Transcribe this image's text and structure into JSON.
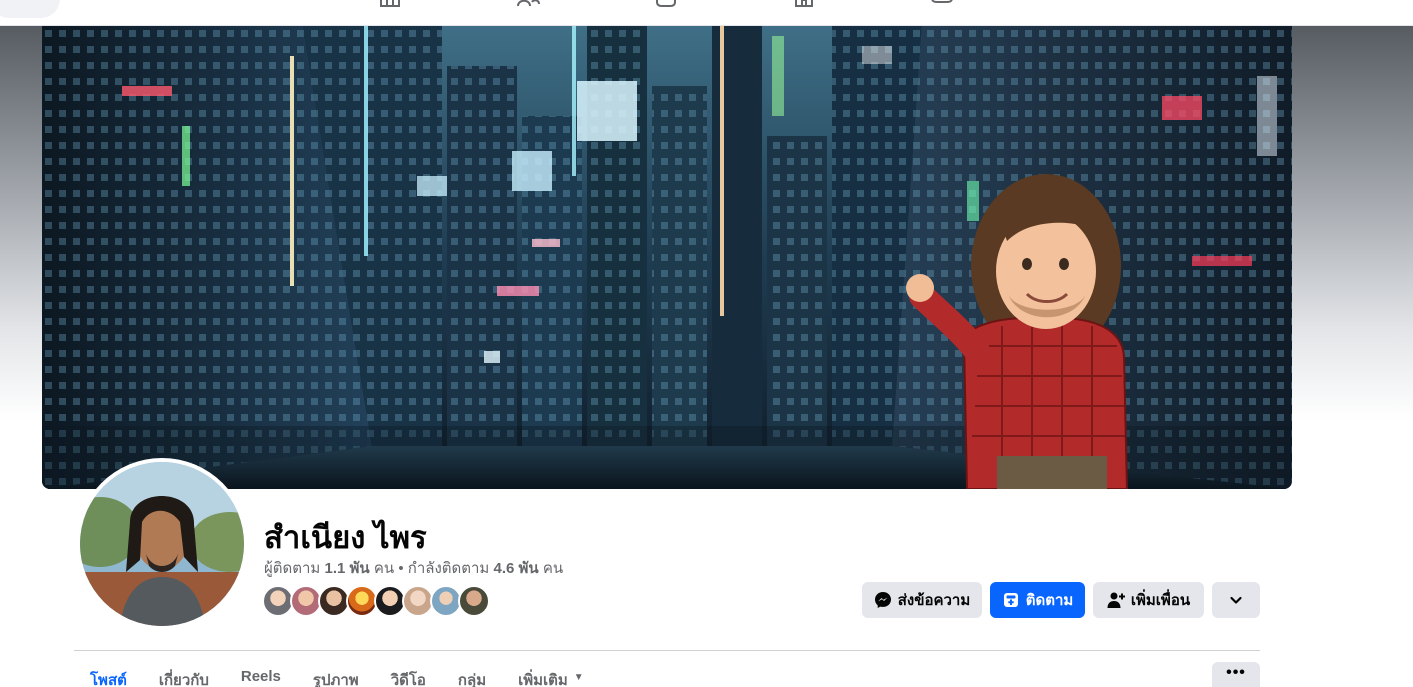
{
  "profile": {
    "name": "สำเนียง ไพร",
    "followers_label": "ผู้ติดตาม",
    "followers_count": "1.1 พัน",
    "followers_unit": "คน",
    "separator": "•",
    "following_label": "กำลังติดตาม",
    "following_count": "4.6 พัน",
    "following_unit": "คน"
  },
  "actions": {
    "message": "ส่งข้อความ",
    "follow": "ติดตาม",
    "add_friend": "เพิ่มเพื่อน"
  },
  "tabs": [
    {
      "label": "โพสต์",
      "active": true
    },
    {
      "label": "เกี่ยวกับ",
      "active": false
    },
    {
      "label": "Reels",
      "active": false
    },
    {
      "label": "รูปภาพ",
      "active": false
    },
    {
      "label": "วิดีโอ",
      "active": false
    },
    {
      "label": "กลุ่ม",
      "active": false
    },
    {
      "label": "เพิ่มเติม",
      "active": false
    }
  ],
  "tab_more_button": "•••",
  "icons": {
    "nav": [
      "home-icon",
      "friends-icon",
      "video-icon",
      "marketplace-icon",
      "gaming-icon"
    ],
    "message": "messenger-icon",
    "follow": "follow-icon",
    "add_friend": "add-friend-icon",
    "more": "chevron-down-icon"
  },
  "colors": {
    "accent": "#0866ff",
    "button_gray": "#e4e6eb",
    "text_primary": "#050505",
    "text_secondary": "#65676b"
  }
}
